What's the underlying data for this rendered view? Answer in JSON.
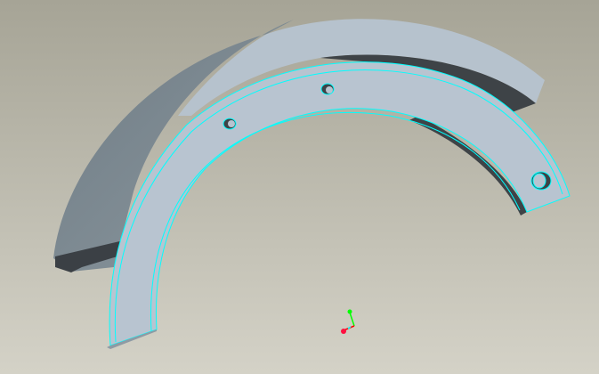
{
  "viewport": {
    "background_top": "#a7a597",
    "background_bottom": "#d3d1c6",
    "part_face_color": "#b7c3cf",
    "part_side_color": "#7a8790",
    "part_dark_color": "#3f4448",
    "edge_highlight_color": "#00ffff"
  },
  "triad": {
    "x_axis_color": "#ff0000",
    "y_axis_color": "#00ff00",
    "z_axis_color": "#00ffff"
  }
}
